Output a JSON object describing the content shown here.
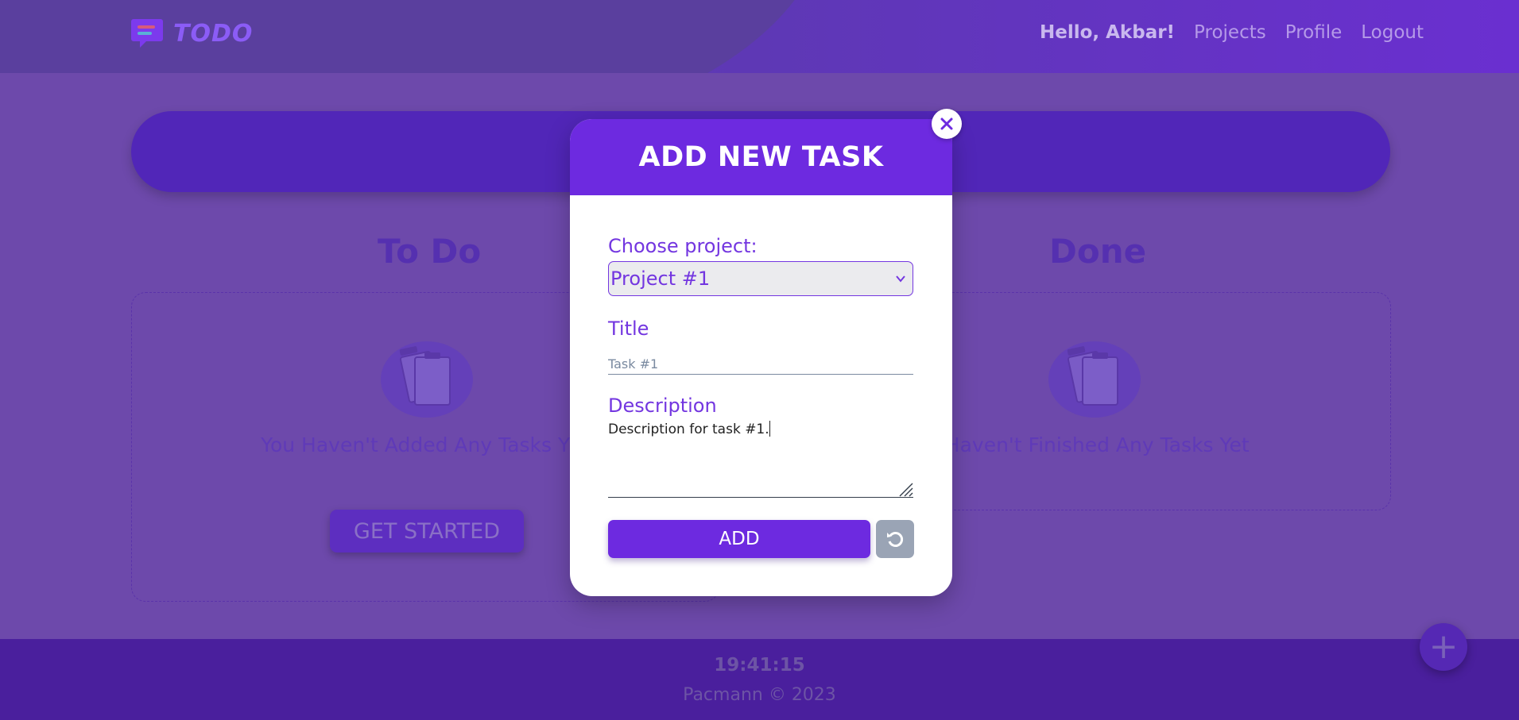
{
  "navbar": {
    "logo_text": "TODO",
    "greeting": "Hello, Akbar!",
    "links": [
      "Projects",
      "Profile",
      "Logout"
    ]
  },
  "board": {
    "todo_title": "To Do",
    "done_title": "Done",
    "todo_empty": "You Haven't Added Any Tasks Y",
    "done_empty": "u Haven't Finished Any Tasks Yet",
    "get_started": "GET STARTED"
  },
  "footer": {
    "time": "19:41:15",
    "copyright": "Pacmann © 2023"
  },
  "modal": {
    "title": "ADD NEW TASK",
    "project_label": "Choose project:",
    "project_selected": "Project #1",
    "title_label": "Title",
    "title_placeholder": "Task #1",
    "description_label": "Description",
    "description_value": "Description for task #1.",
    "add_label": "ADD"
  },
  "icons": {
    "close": "close-icon",
    "reset": "reset-icon",
    "chevron": "chevron-down-icon",
    "fab": "plus-icon"
  },
  "colors": {
    "accent": "#6d2ae0",
    "overlay": "#6d49ab",
    "footer": "#4a1f9d"
  }
}
